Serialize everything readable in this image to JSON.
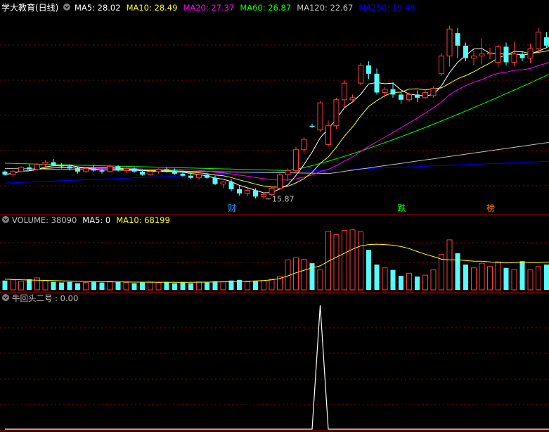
{
  "main_panel": {
    "title": "学大教育(日线)",
    "indicators": [
      {
        "label": "MA5: 28.02",
        "color": "#ffffff"
      },
      {
        "label": "MA10: 28.49",
        "color": "#ffff00"
      },
      {
        "label": "MA20: 27.37",
        "color": "#ff00ff"
      },
      {
        "label": "MA60: 26.87",
        "color": "#00ff00"
      },
      {
        "label": "MA120: 22.67",
        "color": "#c0c0c0"
      },
      {
        "label": "MA250: 19.48",
        "color": "#0000ff"
      }
    ],
    "high_marker": "32.51",
    "low_marker": "15.87",
    "event_marks": [
      {
        "text": "财",
        "color": "#00a0ff"
      },
      {
        "text": "跌",
        "color": "#00ff00"
      },
      {
        "text": "榜",
        "color": "#ff8000"
      }
    ]
  },
  "volume_panel": {
    "indicators": [
      {
        "label": "VOLUME: 38090",
        "color": "#c0c0c0"
      },
      {
        "label": "MA5: 0",
        "color": "#ffffff"
      },
      {
        "label": "MA10: 68199",
        "color": "#ffff00"
      }
    ]
  },
  "signal_panel": {
    "indicators": [
      {
        "label": "牛回头二号 : 0.00",
        "color": "#c0c0c0"
      }
    ]
  },
  "colors": {
    "up": "#ff3c3c",
    "down": "#54fcfc",
    "grid": "#8b0000",
    "separator": "#aa0000",
    "signal": "#ffffff"
  },
  "chart_data": {
    "type": "candlestick",
    "price_range": [
      14.5,
      33.5
    ],
    "volume_range": [
      0,
      95000
    ],
    "signal_range": [
      0,
      1
    ],
    "candles": [
      [
        18.5,
        18.6,
        18.1,
        18.2
      ],
      [
        18.2,
        18.7,
        18.0,
        18.5
      ],
      [
        18.5,
        19.0,
        18.4,
        18.9
      ],
      [
        18.9,
        19.2,
        18.6,
        18.7
      ],
      [
        18.7,
        19.3,
        18.6,
        19.2
      ],
      [
        19.2,
        19.6,
        19.0,
        19.4
      ],
      [
        19.4,
        19.7,
        19.0,
        19.1
      ],
      [
        19.1,
        19.3,
        18.8,
        19.0
      ],
      [
        19.0,
        19.2,
        18.6,
        18.8
      ],
      [
        18.8,
        19.0,
        18.3,
        18.5
      ],
      [
        18.5,
        18.9,
        18.4,
        18.8
      ],
      [
        18.8,
        19.1,
        18.5,
        18.6
      ],
      [
        18.6,
        18.8,
        18.3,
        18.5
      ],
      [
        18.5,
        19.2,
        18.4,
        19.0
      ],
      [
        19.0,
        19.1,
        18.5,
        18.6
      ],
      [
        18.6,
        18.9,
        18.4,
        18.8
      ],
      [
        18.8,
        18.9,
        18.4,
        18.5
      ],
      [
        18.5,
        18.7,
        18.1,
        18.2
      ],
      [
        18.2,
        18.6,
        18.1,
        18.5
      ],
      [
        18.5,
        18.8,
        18.3,
        18.7
      ],
      [
        18.7,
        18.9,
        18.4,
        18.6
      ],
      [
        18.6,
        18.8,
        18.2,
        18.3
      ],
      [
        18.3,
        18.6,
        18.0,
        18.1
      ],
      [
        18.1,
        18.4,
        17.8,
        17.9
      ],
      [
        17.9,
        18.3,
        17.7,
        18.2
      ],
      [
        18.2,
        18.4,
        17.8,
        17.9
      ],
      [
        17.9,
        18.1,
        17.2,
        17.3
      ],
      [
        17.3,
        17.6,
        16.9,
        17.5
      ],
      [
        17.5,
        17.8,
        16.6,
        16.8
      ],
      [
        16.8,
        17.1,
        16.2,
        16.4
      ],
      [
        16.4,
        16.9,
        16.1,
        16.7
      ],
      [
        16.7,
        16.9,
        15.9,
        16.1
      ],
      [
        16.1,
        16.5,
        15.87,
        16.3
      ],
      [
        16.3,
        17.0,
        16.2,
        16.9
      ],
      [
        16.9,
        18.4,
        16.7,
        18.2
      ],
      [
        18.2,
        18.8,
        17.6,
        18.6
      ],
      [
        18.6,
        20.9,
        18.4,
        20.6
      ],
      [
        20.6,
        21.8,
        20.2,
        21.6
      ],
      [
        22.9,
        23.1,
        22.7,
        22.8
      ],
      [
        22.5,
        25.3,
        22.3,
        25.1
      ],
      [
        21.1,
        23.4,
        20.9,
        22.9
      ],
      [
        22.9,
        25.6,
        22.6,
        25.4
      ],
      [
        25.4,
        27.3,
        24.7,
        27.0
      ],
      [
        25.4,
        25.9,
        25.2,
        25.6
      ],
      [
        27.0,
        28.9,
        26.8,
        28.7
      ],
      [
        28.7,
        29.1,
        27.4,
        27.9
      ],
      [
        27.9,
        28.4,
        25.9,
        26.1
      ],
      [
        26.1,
        26.6,
        25.6,
        26.4
      ],
      [
        26.4,
        27.1,
        25.6,
        25.9
      ],
      [
        25.9,
        26.2,
        25.0,
        25.4
      ],
      [
        25.4,
        26.1,
        25.2,
        25.9
      ],
      [
        25.9,
        26.3,
        25.2,
        25.6
      ],
      [
        25.6,
        26.4,
        25.5,
        26.1
      ],
      [
        25.8,
        26.7,
        25.6,
        26.5
      ],
      [
        27.9,
        29.9,
        27.7,
        29.6
      ],
      [
        29.6,
        32.51,
        28.6,
        32.2
      ],
      [
        31.8,
        32.3,
        29.4,
        30.6
      ],
      [
        30.6,
        30.9,
        29.1,
        29.4
      ],
      [
        29.4,
        30.1,
        28.7,
        29.6
      ],
      [
        29.6,
        31.3,
        28.8,
        29.8
      ],
      [
        29.8,
        30.4,
        29.3,
        29.9
      ],
      [
        29.0,
        30.7,
        28.5,
        30.5
      ],
      [
        30.5,
        30.9,
        28.7,
        29.0
      ],
      [
        29.0,
        31.0,
        28.6,
        29.8
      ],
      [
        29.8,
        30.1,
        29.1,
        29.4
      ],
      [
        29.4,
        30.8,
        28.9,
        30.3
      ],
      [
        30.3,
        32.3,
        30.0,
        31.9
      ],
      [
        31.4,
        31.9,
        30.4,
        30.6
      ],
      [
        30.6,
        32.6,
        30.4,
        32.3
      ],
      [
        32.3,
        32.4,
        30.9,
        31.1
      ],
      [
        31.1,
        31.3,
        30.7,
        31.0
      ],
      [
        31.0,
        31.2,
        30.4,
        30.6
      ],
      [
        30.6,
        31.0,
        30.0,
        30.2
      ],
      [
        30.2,
        30.6,
        29.6,
        29.9
      ],
      [
        29.9,
        30.1,
        28.9,
        29.1
      ],
      [
        29.1,
        29.4,
        27.8,
        28.0
      ],
      [
        28.0,
        28.3,
        27.4,
        27.6
      ],
      [
        27.6,
        28.1,
        27.3,
        27.5
      ]
    ],
    "volumes": [
      14000,
      15000,
      13000,
      16000,
      18000,
      14000,
      12000,
      11000,
      12000,
      10000,
      11000,
      12000,
      11000,
      13000,
      12000,
      11000,
      10000,
      11000,
      12000,
      11000,
      12000,
      10000,
      11000,
      10000,
      12000,
      11000,
      13000,
      12000,
      14000,
      15000,
      12000,
      13000,
      14000,
      16000,
      20000,
      45000,
      48000,
      46000,
      40000,
      30000,
      88000,
      83000,
      89000,
      90000,
      87000,
      60000,
      38000,
      33000,
      30000,
      21000,
      25000,
      20000,
      22000,
      30000,
      53000,
      75000,
      55000,
      38000,
      33000,
      40000,
      35000,
      42000,
      33000,
      31000,
      43000,
      30000,
      35000,
      38000,
      24000,
      45000,
      34000,
      30000,
      33000,
      33000,
      28000,
      22000,
      18000,
      15000
    ],
    "volume_ma10": [
      16000,
      15500,
      15200,
      14800,
      14600,
      14300,
      14000,
      13600,
      13300,
      13000,
      12700,
      12400,
      12200,
      12000,
      12000,
      11800,
      11600,
      11600,
      11500,
      11500,
      11500,
      11400,
      11400,
      11400,
      11500,
      11600,
      11800,
      12000,
      12300,
      12700,
      13000,
      13400,
      14000,
      15000,
      17000,
      21000,
      25500,
      29500,
      33000,
      36000,
      43000,
      49000,
      55000,
      61000,
      66000,
      68000,
      68500,
      68000,
      67000,
      65000,
      62000,
      57500,
      53500,
      50000,
      46000,
      45000,
      45000,
      44000,
      43000,
      43000,
      42000,
      41000,
      40500,
      41000,
      41500,
      41000,
      41000,
      41500,
      41500,
      41000,
      40000,
      38500,
      37000,
      35500,
      34000,
      32500,
      31000,
      30000
    ],
    "signal_peak_index": 39,
    "signal_peak_value": 1
  }
}
